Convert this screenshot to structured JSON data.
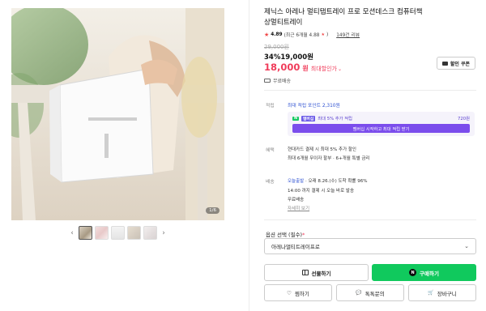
{
  "gallery": {
    "counter": "1/6",
    "prev_arrow": "‹",
    "next_arrow": "›",
    "thumbnail_count": 5
  },
  "product": {
    "title": "제닉스 아레나 멀티탭트레이 프로 모션데스크 컴퓨터책상멀티트레이",
    "rating": "4.89",
    "rating_detail": "(최근 6개월 4.88",
    "rating_detail_end": ")",
    "review_count": "149건 리뷰",
    "original_price": "29,000원",
    "discount_rate": "34%",
    "discount_price": "19,000원",
    "final_price": "18,000",
    "final_unit": "원",
    "final_label": "최대할인가",
    "coupon_label": "할인 쿠폰",
    "delivery_note": "무료배송"
  },
  "points": {
    "row_label": "적립",
    "title": "최대 적립 포인트 2,310원",
    "line_badge_n": "N",
    "line_badge_m": "멤버십",
    "line_text": "최대 5% 추가 적립",
    "amount": "720원",
    "membership_button": "멤버십 시작하고 최대 적립 받기"
  },
  "benefits": {
    "row_label": "혜택",
    "line1": "현대카드 결제 시 최대 5% 추가 할인",
    "line2": "최대 6개월 무이자 할부 · 6+개월 특별 금리"
  },
  "shipping": {
    "row_label": "배송",
    "today_label": "오늘출발",
    "eta": " · 오래 8.26.(수) 도착 확률 96%",
    "cutoff": "14:00 까지 결제 시 오늘 바로 발송",
    "fee": "무료배송",
    "detail_link": "자세히 보기"
  },
  "option": {
    "label": "옵션 선택 (필수)",
    "required_mark": "*",
    "selected": "아레나멀티트레이프로",
    "caret": "⌄"
  },
  "actions": {
    "gift": "선물하기",
    "buy": "구매하기",
    "buy_icon": "N",
    "wishlist": "찜하기",
    "talk": "톡톡문의",
    "cart": "장바구니",
    "heart_icon": "♡",
    "talk_icon": "💬",
    "cart_icon": "🛒"
  }
}
